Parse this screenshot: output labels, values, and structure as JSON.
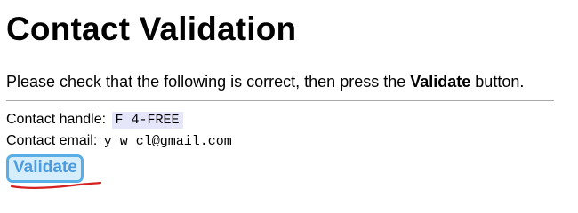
{
  "page": {
    "title": "Contact Validation",
    "instructions": {
      "before": "Please check that the following is correct, then press the ",
      "emphasis": "Validate",
      "after": " button."
    }
  },
  "contact": {
    "handle_label": "Contact handle:",
    "handle_value": "F   4-FREE",
    "email_label": "Contact email:",
    "email_value": "y   w   cl@gmail.com"
  },
  "actions": {
    "validate_label": "Validate"
  },
  "colors": {
    "validate_text": "#4a9be0",
    "validate_border": "#5aaee6",
    "validate_bg": "#d6eefc",
    "handle_highlight": "#e6e6fb",
    "annotation_underline": "#d42020"
  }
}
